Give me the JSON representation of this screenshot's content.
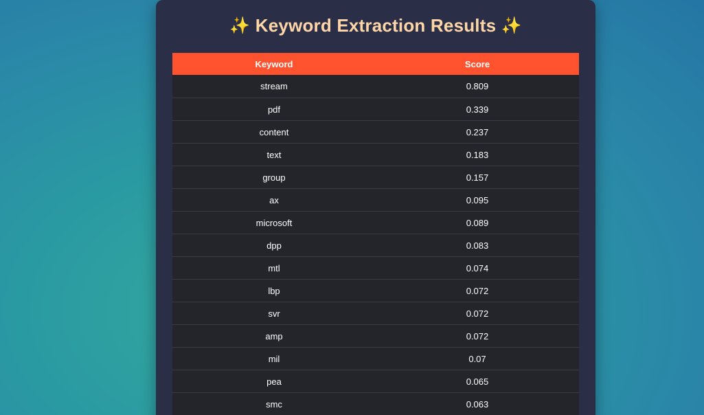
{
  "page": {
    "title": "Keyword Extraction Results",
    "title_icon": "sparkles-icon",
    "title_icon_glyph": "✨"
  },
  "table": {
    "headers": [
      "Keyword",
      "Score"
    ],
    "rows": [
      {
        "keyword": "stream",
        "score": "0.809"
      },
      {
        "keyword": "pdf",
        "score": "0.339"
      },
      {
        "keyword": "content",
        "score": "0.237"
      },
      {
        "keyword": "text",
        "score": "0.183"
      },
      {
        "keyword": "group",
        "score": "0.157"
      },
      {
        "keyword": "ax",
        "score": "0.095"
      },
      {
        "keyword": "microsoft",
        "score": "0.089"
      },
      {
        "keyword": "dpp",
        "score": "0.083"
      },
      {
        "keyword": "mtl",
        "score": "0.074"
      },
      {
        "keyword": "lbp",
        "score": "0.072"
      },
      {
        "keyword": "svr",
        "score": "0.072"
      },
      {
        "keyword": "amp",
        "score": "0.072"
      },
      {
        "keyword": "mil",
        "score": "0.07"
      },
      {
        "keyword": "pea",
        "score": "0.065"
      },
      {
        "keyword": "smc",
        "score": "0.063"
      }
    ]
  },
  "colors": {
    "header_bg": "#fe532e",
    "card_bg": "#2b2e47",
    "row_bg": "#23252b",
    "title_color": "#ffd6a8"
  }
}
